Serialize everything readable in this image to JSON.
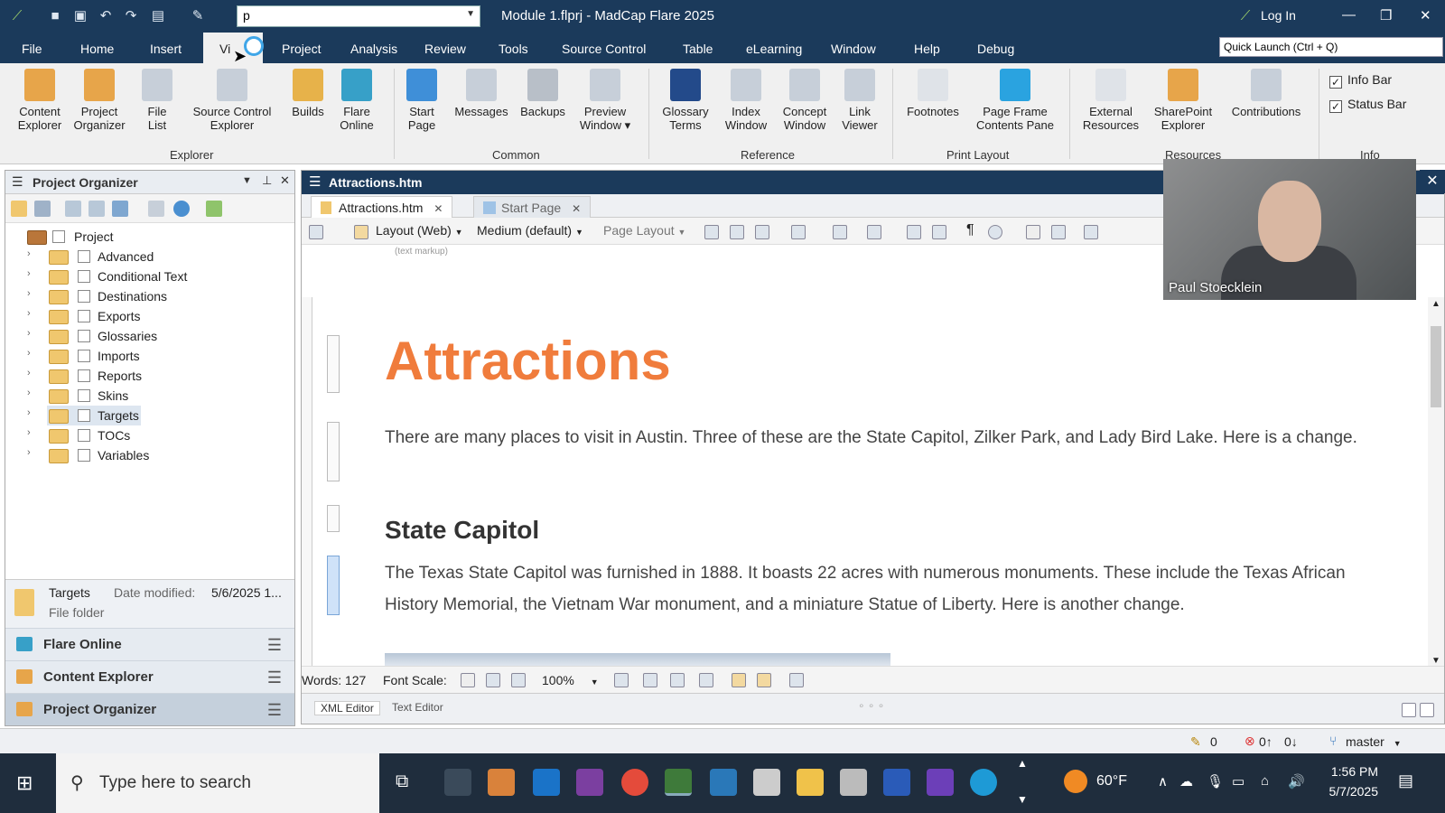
{
  "window": {
    "title": "Module 1.flprj - MadCap Flare 2025",
    "quick_search_value": "p",
    "login_label": "Log In",
    "quick_launch_placeholder": "Quick Launch (Ctrl + Q)"
  },
  "menu": [
    "File",
    "Home",
    "Insert",
    "View",
    "Project",
    "Analysis",
    "Review",
    "Tools",
    "Source Control",
    "Table",
    "eLearning",
    "Window",
    "Help",
    "Debug"
  ],
  "menu_view_visible": "Vi",
  "ribbon": {
    "buttons": [
      {
        "label": "Content\nExplorer",
        "icon": "content-explorer-icon",
        "color": "#e7a54a"
      },
      {
        "label": "Project\nOrganizer",
        "icon": "project-organizer-icon",
        "color": "#e7a54a"
      },
      {
        "label": "File\nList",
        "icon": "file-list-icon",
        "color": "#9aa6b4"
      },
      {
        "label": "Source Control\nExplorer",
        "icon": "source-control-explorer-icon",
        "color": "#9aa6b4"
      },
      {
        "label": "Builds",
        "icon": "builds-icon",
        "color": "#e7b24a"
      },
      {
        "label": "Flare\nOnline",
        "icon": "flare-online-icon",
        "color": "#37a0c8"
      },
      {
        "label": "Start\nPage",
        "icon": "start-page-icon",
        "color": "#3f8fd8"
      },
      {
        "label": "Messages",
        "icon": "messages-icon",
        "color": "#9aa6b4"
      },
      {
        "label": "Backups",
        "icon": "backups-icon",
        "color": "#9aa6b4"
      },
      {
        "label": "Preview\nWindow ▾",
        "icon": "preview-window-icon",
        "color": "#9aa6b4"
      },
      {
        "label": "Glossary\nTerms",
        "icon": "glossary-terms-icon",
        "color": "#234a8a"
      },
      {
        "label": "Index\nWindow",
        "icon": "index-window-icon",
        "color": "#9aa6b4"
      },
      {
        "label": "Concept\nWindow",
        "icon": "concept-window-icon",
        "color": "#9aa6b4"
      },
      {
        "label": "Link\nViewer",
        "icon": "link-viewer-icon",
        "color": "#9aa6b4"
      },
      {
        "label": "Footnotes",
        "icon": "footnotes-icon",
        "color": "#9aa6b4"
      },
      {
        "label": "Page Frame\nContents Pane",
        "icon": "page-frame-contents-icon",
        "color": "#2aa3e0"
      },
      {
        "label": "External\nResources",
        "icon": "external-resources-icon",
        "color": "#9aa6b4"
      },
      {
        "label": "SharePoint\nExplorer",
        "icon": "sharepoint-explorer-icon",
        "color": "#e7a54a"
      },
      {
        "label": "Contributions",
        "icon": "contributions-icon",
        "color": "#9aa6b4"
      }
    ],
    "groups": [
      "Explorer",
      "Common",
      "Reference",
      "Print Layout",
      "Resources",
      "Info"
    ],
    "checkboxes": [
      {
        "label": "Info Bar",
        "checked": "✓"
      },
      {
        "label": "Status Bar",
        "checked": "✓"
      }
    ]
  },
  "left_panel": {
    "title": "Project Organizer",
    "tree": [
      "Project",
      "Advanced",
      "Conditional Text",
      "Destinations",
      "Exports",
      "Glossaries",
      "Imports",
      "Reports",
      "Skins",
      "Targets",
      "TOCs",
      "Variables"
    ],
    "info": {
      "name": "Targets",
      "type": "File folder",
      "date_label": "Date modified:",
      "date_value": "5/6/2025 1..."
    },
    "accordion": [
      "Flare Online",
      "Content Explorer",
      "Project Organizer"
    ]
  },
  "editor": {
    "title": "Attractions.htm",
    "tabs": [
      {
        "label": "Attractions.htm"
      },
      {
        "label": "Start Page"
      }
    ],
    "toolbar": {
      "layout": "Layout (Web)",
      "medium": "Medium (default)",
      "page_layout": "Page Layout"
    },
    "text_markup_label": "(text markup)",
    "doc": {
      "h1": "Attractions",
      "p1": "There are many places to visit in Austin. Three of these are the State Capitol, Zilker Park, and Lady Bird Lake. Here is a change.",
      "h2": "State Capitol",
      "p2": "The Texas State Capitol was furnished in 1888. It boasts 22 acres with numerous monuments. These include the Texas African History Memorial, the Vietnam War monument, and a miniature Statue of Liberty. Here is another change."
    },
    "status": {
      "words": "Words: 127",
      "font_scale": "Font Scale:",
      "zoom": "100%"
    },
    "bottom_tabs": [
      "XML Editor",
      "Text Editor"
    ]
  },
  "app_status": {
    "edits": "0",
    "errors_up": "0↑",
    "errors_down": "0↓",
    "branch": "master"
  },
  "webcam": {
    "name": "Paul Stoecklein"
  },
  "taskbar": {
    "search_placeholder": "Type here to search",
    "weather": "60°F",
    "time": "1:56 PM",
    "date": "5/7/2025"
  }
}
